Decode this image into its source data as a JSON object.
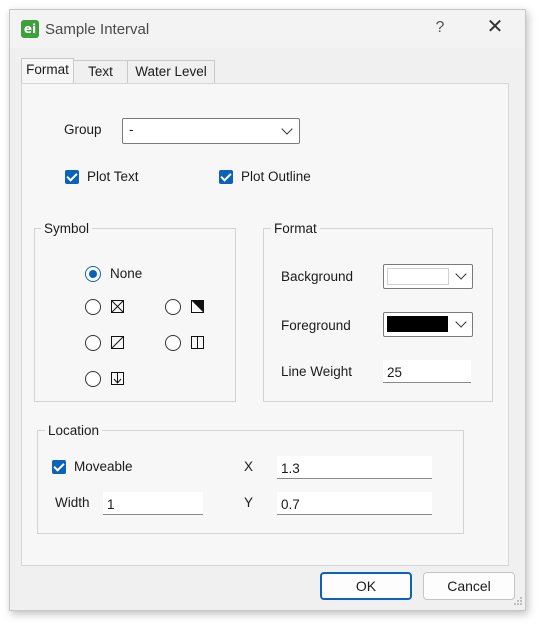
{
  "window": {
    "title": "Sample Interval",
    "help_glyph": "?",
    "close_glyph": "✕",
    "app_icon_text": "ei"
  },
  "tabs": [
    {
      "label": "Format",
      "active": true
    },
    {
      "label": "Text",
      "active": false
    },
    {
      "label": "Water Level",
      "active": false
    }
  ],
  "format_tab": {
    "group_label": "Group",
    "group_value": "-",
    "plot_text": {
      "label": "Plot Text",
      "checked": true
    },
    "plot_outline": {
      "label": "Plot Outline",
      "checked": true
    },
    "symbol": {
      "title": "Symbol",
      "options": [
        {
          "id": "none",
          "label": "None",
          "selected": true
        },
        {
          "id": "box-x",
          "label": "",
          "selected": false
        },
        {
          "id": "box-triangle",
          "label": "",
          "selected": false
        },
        {
          "id": "box-slash",
          "label": "",
          "selected": false
        },
        {
          "id": "box-vertical",
          "label": "",
          "selected": false
        },
        {
          "id": "box-arrow-down",
          "label": "",
          "selected": false
        }
      ]
    },
    "format": {
      "title": "Format",
      "background_label": "Background",
      "background_color": "#ffffff",
      "foreground_label": "Foreground",
      "foreground_color": "#000000",
      "line_weight_label": "Line Weight",
      "line_weight_value": "25"
    },
    "location": {
      "title": "Location",
      "moveable": {
        "label": "Moveable",
        "checked": true
      },
      "width_label": "Width",
      "width_value": "1",
      "x_label": "X",
      "x_value": "1.3",
      "y_label": "Y",
      "y_value": "0.7"
    }
  },
  "buttons": {
    "ok": "OK",
    "cancel": "Cancel"
  },
  "colors": {
    "accent": "#0a63b8",
    "app_icon": "#3f9f3f"
  }
}
